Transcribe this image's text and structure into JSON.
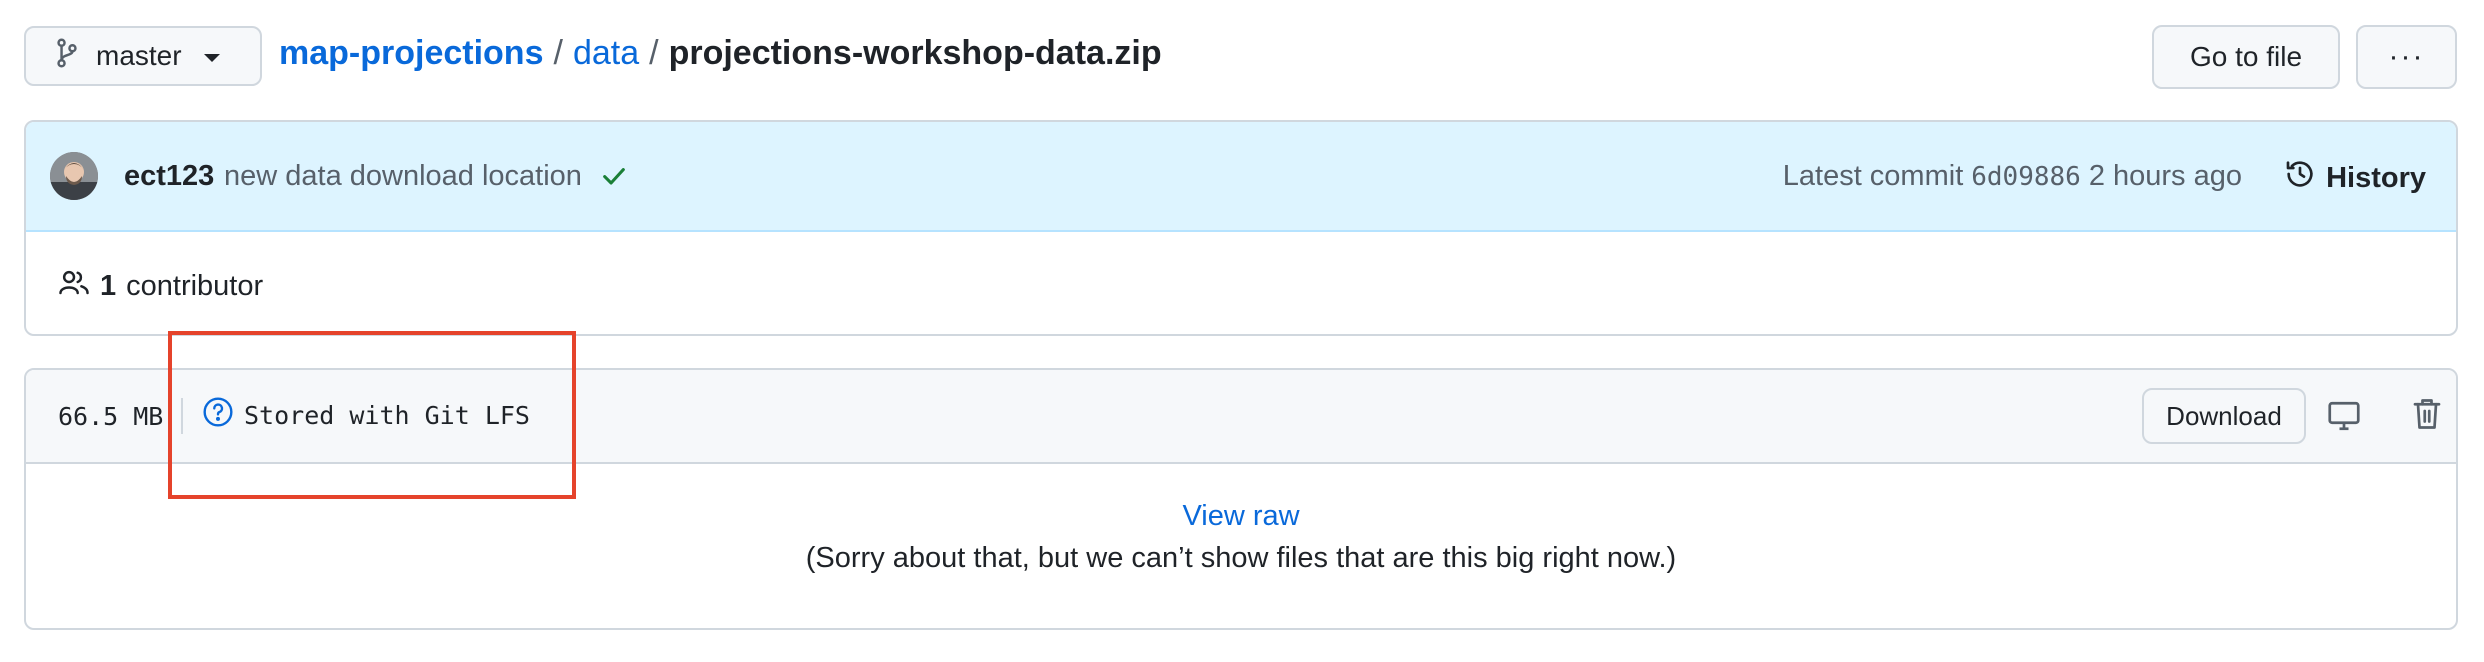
{
  "header": {
    "branch": "master",
    "breadcrumb": {
      "repo": "map-projections",
      "folder": "data",
      "file": "projections-workshop-data.zip",
      "separator": "/"
    },
    "go_to_file_label": "Go to file",
    "more_label": "···"
  },
  "commit": {
    "author": "ect123",
    "message": "new data download location",
    "latest_label": "Latest commit",
    "sha": "6d09886",
    "time": "2 hours ago",
    "history_label": "History",
    "status": "success"
  },
  "contributors": {
    "count": "1",
    "label": "contributor"
  },
  "file": {
    "size": "66.5 MB",
    "lfs_label": "Stored with Git LFS",
    "download_label": "Download",
    "view_raw_label": "View raw",
    "notice": "(Sorry about that, but we can’t show files that are this big right now.)"
  },
  "colors": {
    "link": "#0969da",
    "commit_bg": "#ddf4ff",
    "success": "#1a7f37",
    "highlight": "#e5432b"
  }
}
